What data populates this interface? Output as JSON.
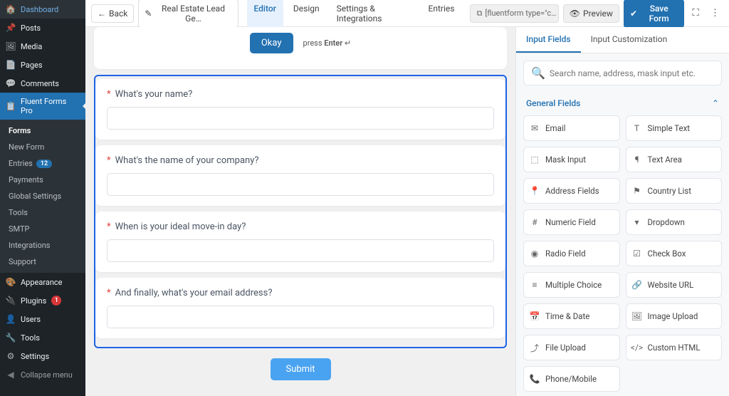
{
  "sidebar": {
    "items": [
      {
        "icon": "🏠",
        "label": "Dashboard"
      },
      {
        "icon": "📌",
        "label": "Posts"
      },
      {
        "icon": "🖼",
        "label": "Media"
      },
      {
        "icon": "📄",
        "label": "Pages"
      },
      {
        "icon": "💬",
        "label": "Comments"
      }
    ],
    "active": {
      "icon": "📋",
      "label": "Fluent Forms Pro"
    },
    "sub": [
      {
        "label": "Forms",
        "active": true
      },
      {
        "label": "New Form"
      },
      {
        "label": "Entries",
        "badge": "12"
      },
      {
        "label": "Payments"
      },
      {
        "label": "Global Settings"
      },
      {
        "label": "Tools"
      },
      {
        "label": "SMTP"
      },
      {
        "label": "Integrations"
      },
      {
        "label": "Support"
      }
    ],
    "lower": [
      {
        "icon": "🎨",
        "label": "Appearance"
      },
      {
        "icon": "🔌",
        "label": "Plugins",
        "badge_red": "1"
      },
      {
        "icon": "👤",
        "label": "Users"
      },
      {
        "icon": "🔧",
        "label": "Tools"
      },
      {
        "icon": "⚙",
        "label": "Settings"
      }
    ],
    "collapse": {
      "icon": "◀",
      "label": "Collapse menu"
    }
  },
  "topbar": {
    "back": "Back",
    "title": "Real Estate Lead Ge…",
    "tabs": [
      "Editor",
      "Design",
      "Settings & Integrations",
      "Entries"
    ],
    "shortcode": "[fluentform type=\"c…",
    "preview": "Preview",
    "save": "Save Form"
  },
  "form": {
    "okay_label": "Okay",
    "enter_prefix": "press ",
    "enter_bold": "Enter",
    "enter_symbol": " ↵",
    "questions": [
      {
        "label": "What's your name?"
      },
      {
        "label": "What's the name of your company?"
      },
      {
        "label": "When is your ideal move-in day?"
      },
      {
        "label": "And finally, what's your email address?"
      }
    ],
    "submit": "Submit"
  },
  "rightpanel": {
    "tabs": [
      "Input Fields",
      "Input Customization"
    ],
    "search_placeholder": "Search name, address, mask input etc.",
    "section": "General Fields",
    "fields": [
      {
        "icon": "✉",
        "label": "Email"
      },
      {
        "icon": "T",
        "label": "Simple Text"
      },
      {
        "icon": "⬚",
        "label": "Mask Input"
      },
      {
        "icon": "¶",
        "label": "Text Area"
      },
      {
        "icon": "📍",
        "label": "Address Fields"
      },
      {
        "icon": "⚑",
        "label": "Country List"
      },
      {
        "icon": "#",
        "label": "Numeric Field"
      },
      {
        "icon": "▾",
        "label": "Dropdown"
      },
      {
        "icon": "◉",
        "label": "Radio Field"
      },
      {
        "icon": "☑",
        "label": "Check Box"
      },
      {
        "icon": "≡",
        "label": "Multiple Choice"
      },
      {
        "icon": "🔗",
        "label": "Website URL"
      },
      {
        "icon": "📅",
        "label": "Time & Date"
      },
      {
        "icon": "🖼",
        "label": "Image Upload"
      },
      {
        "icon": "⤴",
        "label": "File Upload"
      },
      {
        "icon": "</>",
        "label": "Custom HTML"
      },
      {
        "icon": "📞",
        "label": "Phone/Mobile"
      }
    ]
  }
}
